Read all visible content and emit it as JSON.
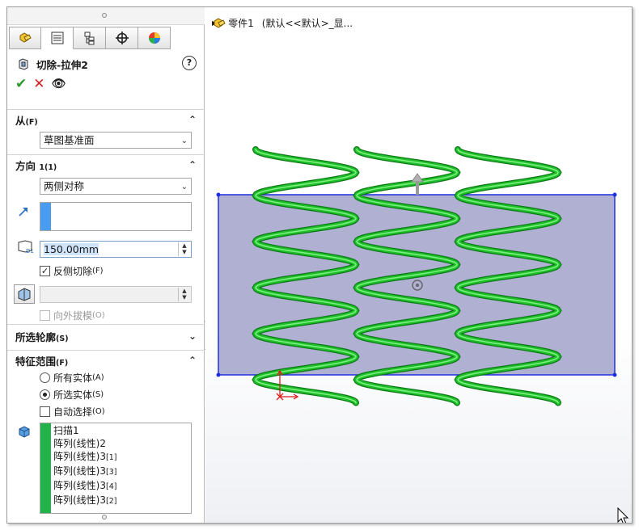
{
  "tabs": [
    {
      "icon": "feature-manager-icon"
    },
    {
      "icon": "property-manager-icon"
    },
    {
      "icon": "configuration-manager-icon"
    },
    {
      "icon": "dimxpert-manager-icon"
    },
    {
      "icon": "display-manager-icon"
    }
  ],
  "feature": {
    "title": "切除-拉伸2",
    "help": "?",
    "ok": "✔",
    "cancel": "✕",
    "preview": "👁"
  },
  "from": {
    "header": "从",
    "header_suffix": "(F)",
    "value": "草图基准面"
  },
  "direction1": {
    "header": "方向",
    "header_suffix": "1(1)",
    "end_condition": "两侧对称",
    "depth": "150.00mm",
    "flip_side_label": "反侧切除",
    "flip_side_suffix": "(F)",
    "flip_side_checked": true,
    "draft_label": "向外拔模",
    "draft_suffix": "(O)"
  },
  "selected_contours": {
    "header": "所选轮廓",
    "header_suffix": "(S)"
  },
  "feature_scope": {
    "header": "特征范围",
    "header_suffix": "(F)",
    "all_bodies_label": "所有实体",
    "all_bodies_suffix": "(A)",
    "selected_bodies_label": "所选实体",
    "selected_bodies_suffix": "(S)",
    "auto_select_label": "自动选择",
    "auto_select_suffix": "(O)",
    "bodies": [
      {
        "name": "扫描1",
        "sub": ""
      },
      {
        "name": "阵列(线性)2",
        "sub": ""
      },
      {
        "name": "阵列(线性)3",
        "sub": "[1]"
      },
      {
        "name": "阵列(线性)3",
        "sub": "[3]"
      },
      {
        "name": "阵列(线性)3",
        "sub": "[4]"
      },
      {
        "name": "阵列(线性)3",
        "sub": "[2]"
      }
    ]
  },
  "viewport": {
    "tree_part": "零件1",
    "tree_config": "(默认<<默认>_显..."
  },
  "colors": {
    "accent_blue": "#4a9cf0",
    "body_green": "#21b24b",
    "helix_green": "#1fbf2a",
    "sketch_blue": "#1f2fe0",
    "plane_fill": "#a9a9cf"
  }
}
